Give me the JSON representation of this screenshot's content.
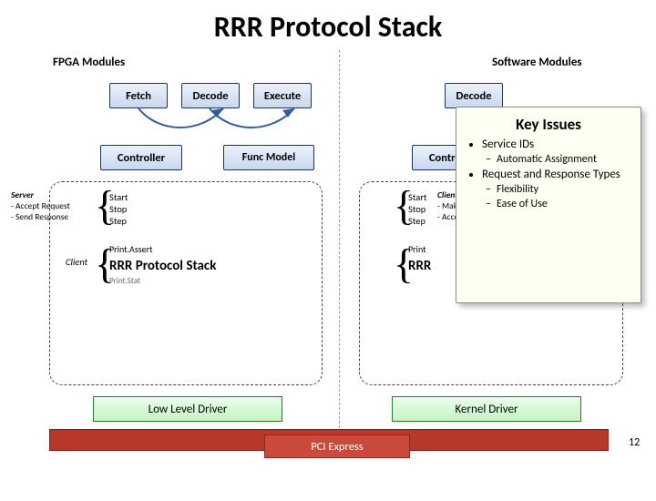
{
  "title": "RRR Protocol Stack",
  "labels": {
    "fpga": "FPGA Modules",
    "software": "Software Modules",
    "server": "Server",
    "server_sub1": "- Accept Request",
    "server_sub2": "- Send Response",
    "client": "Client",
    "client_r": "Client",
    "client_sub1": "- Make Request",
    "client_sub2": "- Accept Response"
  },
  "boxes": {
    "fetch": "Fetch",
    "decode": "Decode",
    "execute": "Execute",
    "controller_l": "Controller",
    "funcmodel_l": "Func Model",
    "controller_r": "Controller",
    "decode_r": "Decode",
    "rrr_l": "RRR Protocol Stack",
    "rrr_r": "RRR",
    "low_driver": "Low Level Driver",
    "kernel_driver": "Kernel Driver",
    "pci": "PCI Express"
  },
  "lists": {
    "sss_l": [
      "Start",
      "Stop",
      "Step"
    ],
    "sss_r": [
      "Start",
      "Stop",
      "Step"
    ],
    "prints_l": [
      "Print.Assert",
      "",
      "Print.Stat"
    ],
    "prints_r": [
      "Print"
    ]
  },
  "overlay": {
    "title": "Key Issues",
    "b1": "Service IDs",
    "b1a": "Automatic Assignment",
    "b2": "Request and Response Types",
    "b2a": "Flexibility",
    "b2b": "Ease of Use"
  },
  "pagenum": "12"
}
